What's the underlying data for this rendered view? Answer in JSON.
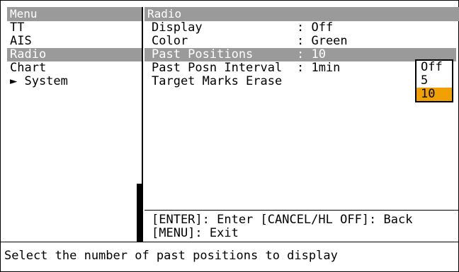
{
  "menu": {
    "title": "Menu",
    "items": [
      {
        "label": "TT"
      },
      {
        "label": "AIS"
      },
      {
        "label": "Radio"
      },
      {
        "label": "Chart"
      },
      {
        "label": "► System"
      }
    ]
  },
  "radio": {
    "title": "Radio",
    "rows": [
      {
        "label": "Display",
        "value": ": Off"
      },
      {
        "label": "Color",
        "value": ": Green"
      },
      {
        "label": "Past Positions",
        "value": ": 10"
      },
      {
        "label": "Past Posn Interval",
        "value": ": 1min"
      },
      {
        "label": "Target Marks Erase",
        "value": ""
      }
    ],
    "dropdown": [
      "Off",
      "5",
      "10"
    ],
    "help_line1": "[ENTER]: Enter [CANCEL/HL OFF]: Back",
    "help_line2": "[MENU]: Exit"
  },
  "status": "Select the number of past positions to display",
  "colors": {
    "highlight_gray": "#9a9a9a",
    "selected_orange": "#f0a000"
  }
}
